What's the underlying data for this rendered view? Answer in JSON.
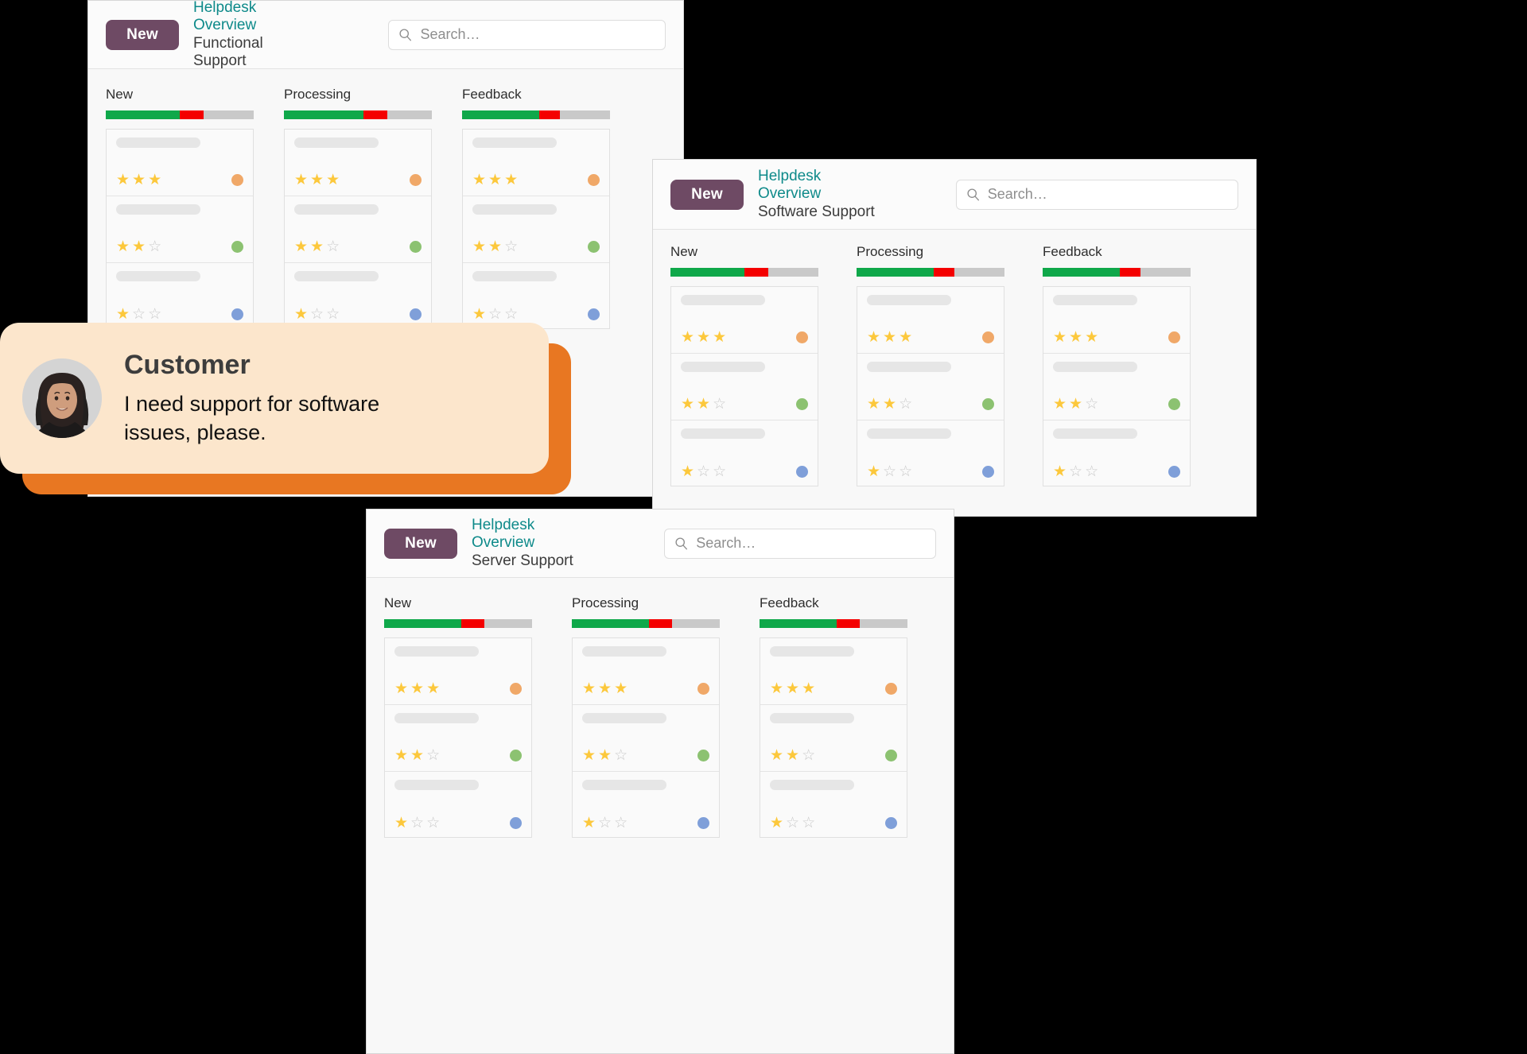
{
  "windows": [
    {
      "id": "functional",
      "badge": "New",
      "title": "Helpdesk Overview",
      "subtitle": "Functional Support",
      "search": {
        "placeholder": "Search…",
        "value": "",
        "icon": "search-icon"
      },
      "columns": [
        {
          "label": "New",
          "progress": {
            "green_pct": 50,
            "red_pct": 16,
            "grey_pct": 34
          },
          "cards": [
            {
              "stars_filled": 3,
              "stars_total": 3,
              "dot_color": "#f0a868"
            },
            {
              "stars_filled": 2,
              "stars_total": 3,
              "dot_color": "#8cc271"
            },
            {
              "stars_filled": 1,
              "stars_total": 3,
              "dot_color": "#7f9fd9"
            }
          ]
        },
        {
          "label": "Processing",
          "progress": {
            "green_pct": 54,
            "red_pct": 16,
            "grey_pct": 30
          },
          "cards": [
            {
              "stars_filled": 3,
              "stars_total": 3,
              "dot_color": "#f0a868"
            },
            {
              "stars_filled": 2,
              "stars_total": 3,
              "dot_color": "#8cc271"
            },
            {
              "stars_filled": 1,
              "stars_total": 3,
              "dot_color": "#7f9fd9"
            }
          ]
        },
        {
          "label": "Feedback",
          "progress": {
            "green_pct": 52,
            "red_pct": 14,
            "grey_pct": 34
          },
          "cards": [
            {
              "stars_filled": 3,
              "stars_total": 3,
              "dot_color": "#f0a868"
            },
            {
              "stars_filled": 2,
              "stars_total": 3,
              "dot_color": "#8cc271"
            },
            {
              "stars_filled": 1,
              "stars_total": 3,
              "dot_color": "#7f9fd9"
            }
          ]
        }
      ]
    },
    {
      "id": "software",
      "badge": "New",
      "title": "Helpdesk Overview",
      "subtitle": "Software Support",
      "search": {
        "placeholder": "Search…",
        "value": "",
        "icon": "search-icon"
      },
      "columns": [
        {
          "label": "New",
          "progress": {
            "green_pct": 50,
            "red_pct": 16,
            "grey_pct": 34
          },
          "cards": [
            {
              "stars_filled": 3,
              "stars_total": 3,
              "dot_color": "#f0a868"
            },
            {
              "stars_filled": 2,
              "stars_total": 3,
              "dot_color": "#8cc271"
            },
            {
              "stars_filled": 1,
              "stars_total": 3,
              "dot_color": "#7f9fd9"
            }
          ]
        },
        {
          "label": "Processing",
          "progress": {
            "green_pct": 52,
            "red_pct": 14,
            "grey_pct": 34
          },
          "cards": [
            {
              "stars_filled": 3,
              "stars_total": 3,
              "dot_color": "#f0a868"
            },
            {
              "stars_filled": 2,
              "stars_total": 3,
              "dot_color": "#8cc271"
            },
            {
              "stars_filled": 1,
              "stars_total": 3,
              "dot_color": "#7f9fd9"
            }
          ]
        },
        {
          "label": "Feedback",
          "progress": {
            "green_pct": 52,
            "red_pct": 14,
            "grey_pct": 34
          },
          "cards": [
            {
              "stars_filled": 3,
              "stars_total": 3,
              "dot_color": "#f0a868"
            },
            {
              "stars_filled": 2,
              "stars_total": 3,
              "dot_color": "#8cc271"
            },
            {
              "stars_filled": 1,
              "stars_total": 3,
              "dot_color": "#7f9fd9"
            }
          ]
        }
      ]
    },
    {
      "id": "server",
      "badge": "New",
      "title": "Helpdesk Overview",
      "subtitle": "Server Support",
      "search": {
        "placeholder": "Search…",
        "value": "",
        "icon": "search-icon"
      },
      "columns": [
        {
          "label": "New",
          "progress": {
            "green_pct": 52,
            "red_pct": 16,
            "grey_pct": 32
          },
          "cards": [
            {
              "stars_filled": 3,
              "stars_total": 3,
              "dot_color": "#f0a868"
            },
            {
              "stars_filled": 2,
              "stars_total": 3,
              "dot_color": "#8cc271"
            },
            {
              "stars_filled": 1,
              "stars_total": 3,
              "dot_color": "#7f9fd9"
            }
          ]
        },
        {
          "label": "Processing",
          "progress": {
            "green_pct": 52,
            "red_pct": 16,
            "grey_pct": 32
          },
          "cards": [
            {
              "stars_filled": 3,
              "stars_total": 3,
              "dot_color": "#f0a868"
            },
            {
              "stars_filled": 2,
              "stars_total": 3,
              "dot_color": "#8cc271"
            },
            {
              "stars_filled": 1,
              "stars_total": 3,
              "dot_color": "#7f9fd9"
            }
          ]
        },
        {
          "label": "Feedback",
          "progress": {
            "green_pct": 52,
            "red_pct": 16,
            "grey_pct": 32
          },
          "cards": [
            {
              "stars_filled": 3,
              "stars_total": 3,
              "dot_color": "#f0a868"
            },
            {
              "stars_filled": 2,
              "stars_total": 3,
              "dot_color": "#8cc271"
            },
            {
              "stars_filled": 1,
              "stars_total": 3,
              "dot_color": "#7f9fd9"
            }
          ]
        }
      ]
    }
  ],
  "bubble": {
    "name": "Customer",
    "message": "I need support for software issues, please.",
    "avatar_alt": "customer-avatar",
    "bg_color": "#fce6cc",
    "shadow_color": "#e87722"
  },
  "colors": {
    "badge": "#6e4a64",
    "title": "#0e8a8a",
    "progress_green": "#0fa84a",
    "progress_red": "#f40000",
    "progress_grey": "#c9c9c9",
    "star_on": "#fcc83c",
    "star_off": "#c9c9c9",
    "dot_orange": "#f0a868",
    "dot_green": "#8cc271",
    "dot_blue": "#7f9fd9"
  },
  "glyphs": {
    "star_filled": "★",
    "star_empty": "☆"
  }
}
